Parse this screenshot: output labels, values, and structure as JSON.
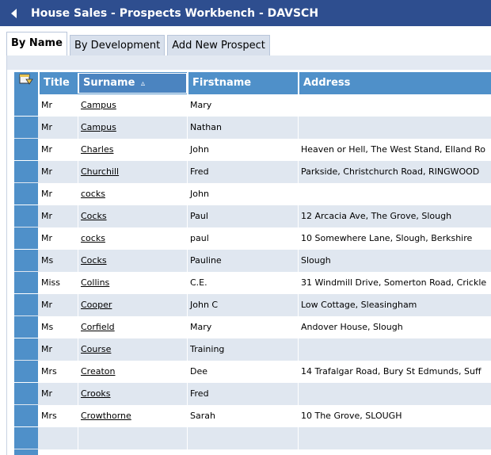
{
  "window": {
    "title": "House Sales - Prospects Workbench - DAVSCH"
  },
  "tabs": [
    {
      "label": "By Name",
      "active": true
    },
    {
      "label": "By Development",
      "active": false
    },
    {
      "label": "Add New Prospect",
      "active": false
    }
  ],
  "grid": {
    "corner_icon": "column-chooser-icon",
    "columns": {
      "title": "Title",
      "surname": "Surname",
      "surname_sort": "▵",
      "firstname": "Firstname",
      "address": "Address"
    },
    "rows": [
      {
        "title": "Mr",
        "surname": "Campus",
        "firstname": "Mary",
        "address": ""
      },
      {
        "title": "Mr",
        "surname": "Campus",
        "firstname": "Nathan",
        "address": ""
      },
      {
        "title": "Mr",
        "surname": "Charles",
        "firstname": "John",
        "address": "Heaven or Hell, The West Stand, Elland Ro"
      },
      {
        "title": "Mr",
        "surname": "Churchill",
        "firstname": "Fred",
        "address": "Parkside, Christchurch Road, RINGWOOD"
      },
      {
        "title": "Mr",
        "surname": "cocks",
        "firstname": "John",
        "address": ""
      },
      {
        "title": "Mr",
        "surname": "Cocks",
        "firstname": "Paul",
        "address": "12 Arcacia Ave, The Grove, Slough"
      },
      {
        "title": "Mr",
        "surname": "cocks",
        "firstname": "paul",
        "address": "10 Somewhere Lane, Slough, Berkshire"
      },
      {
        "title": "Ms",
        "surname": "Cocks",
        "firstname": "Pauline",
        "address": "Slough"
      },
      {
        "title": "Miss",
        "surname": "Collins",
        "firstname": "C.E.",
        "address": "31 Windmill Drive, Somerton Road, Crickle"
      },
      {
        "title": "Mr",
        "surname": "Cooper",
        "firstname": "John C",
        "address": "Low Cottage, Sleasingham"
      },
      {
        "title": "Ms",
        "surname": "Corfield",
        "firstname": "Mary",
        "address": "Andover House, Slough"
      },
      {
        "title": "Mr",
        "surname": "Course",
        "firstname": "Training",
        "address": ""
      },
      {
        "title": "Mrs",
        "surname": "Creaton",
        "firstname": "Dee",
        "address": "14 Trafalgar Road, Bury St Edmunds, Suff"
      },
      {
        "title": "Mr",
        "surname": "Crooks",
        "firstname": "Fred",
        "address": ""
      },
      {
        "title": "Mrs",
        "surname": "Crowthorne",
        "firstname": "Sarah",
        "address": "10 The Grove, SLOUGH"
      },
      {
        "title": "",
        "surname": "",
        "firstname": "",
        "address": ""
      },
      {
        "title": "",
        "surname": "",
        "firstname": "",
        "address": ""
      }
    ]
  },
  "colors": {
    "titlebar": "#2e4e8f",
    "header": "#4f90c9",
    "row_alt": "#e0e7f0"
  }
}
